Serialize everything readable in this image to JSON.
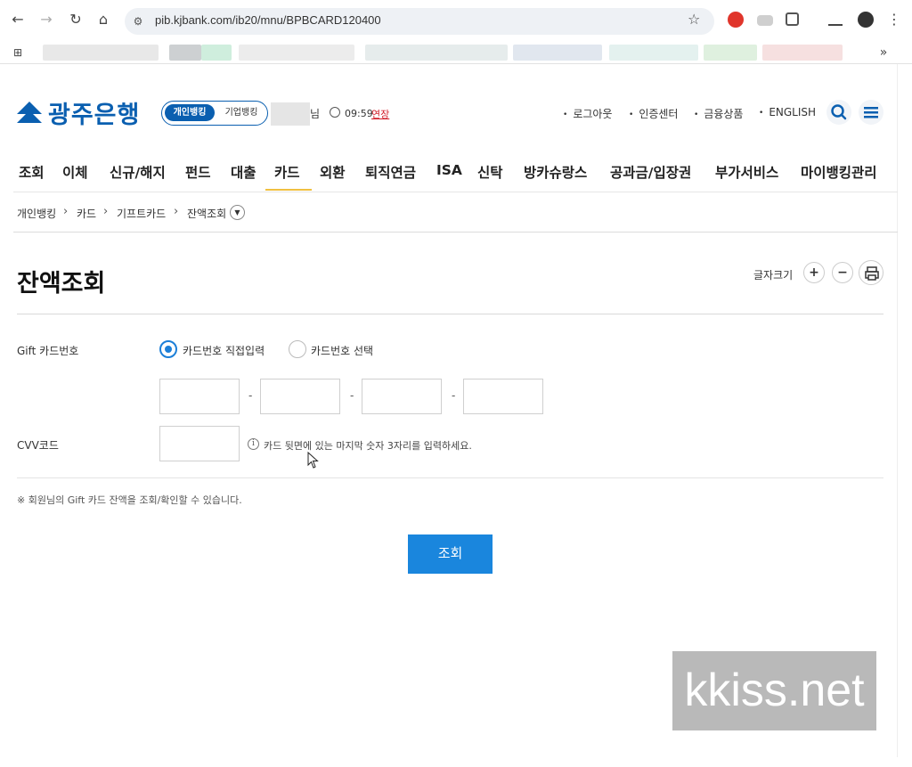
{
  "browser": {
    "url": "pib.kjbank.com/ib20/mnu/BPBCARD120400",
    "bookmarks_overflow": "»"
  },
  "header": {
    "logo_text": "광주은행",
    "toggle_personal": "개인뱅킹",
    "toggle_corporate": "기업뱅킹",
    "user_suffix": "님",
    "session_time": "09:59",
    "extend_label": "연장",
    "util_links": [
      "로그아웃",
      "인증센터",
      "금융상품",
      "ENGLISH"
    ]
  },
  "gnb": {
    "items": [
      "조회",
      "이체",
      "신규/해지",
      "펀드",
      "대출",
      "카드",
      "외환",
      "퇴직연금",
      "ISA",
      "신탁",
      "방카슈랑스",
      "공과금/입장권",
      "부가서비스",
      "마이뱅킹관리"
    ],
    "active": "카드"
  },
  "breadcrumb": [
    "개인뱅킹",
    "카드",
    "기프트카드",
    "잔액조회"
  ],
  "main": {
    "title": "잔액조회",
    "font_size_label": "글자크기",
    "form": {
      "card_number_label": "Gift 카드번호",
      "radio_direct": "카드번호 직접입력",
      "radio_select": "카드번호 선택",
      "selected_radio": "카드번호 직접입력",
      "separator": "-",
      "cvv_label": "CVV코드",
      "cvv_hint": "카드 뒷면에 있는 마지막 숫자 3자리를 입력하세요."
    },
    "note": "※ 회원님의 Gift 카드 잔액을 조회/확인할 수 있습니다.",
    "submit_label": "조회"
  },
  "watermark": "kkiss.net",
  "colors": {
    "brand_blue": "#0a5fb0",
    "button_blue": "#1a86dd",
    "extend_red": "#d21f2a",
    "active_underline": "#f0c040"
  }
}
